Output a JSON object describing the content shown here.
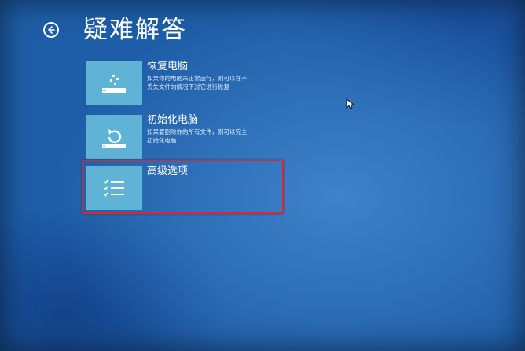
{
  "header": {
    "title": "疑难解答",
    "back_icon": "back-arrow-circle-icon"
  },
  "options": [
    {
      "title": "恢复电脑",
      "desc_line1": "如果你的电脑未正常运行，则可以在不",
      "desc_line2": "丢失文件的情况下对它进行恢复",
      "icon": "refresh-pc-icon"
    },
    {
      "title": "初始化电脑",
      "desc_line1": "如果要删除你的所有文件，则可以完全",
      "desc_line2": "初始化电脑",
      "icon": "reset-pc-icon"
    },
    {
      "title": "高级选项",
      "icon": "advanced-options-checklist-icon"
    }
  ],
  "colors": {
    "background": "#1e5ea8",
    "tile": "#5fb4d6",
    "highlight": "#d22b35"
  }
}
